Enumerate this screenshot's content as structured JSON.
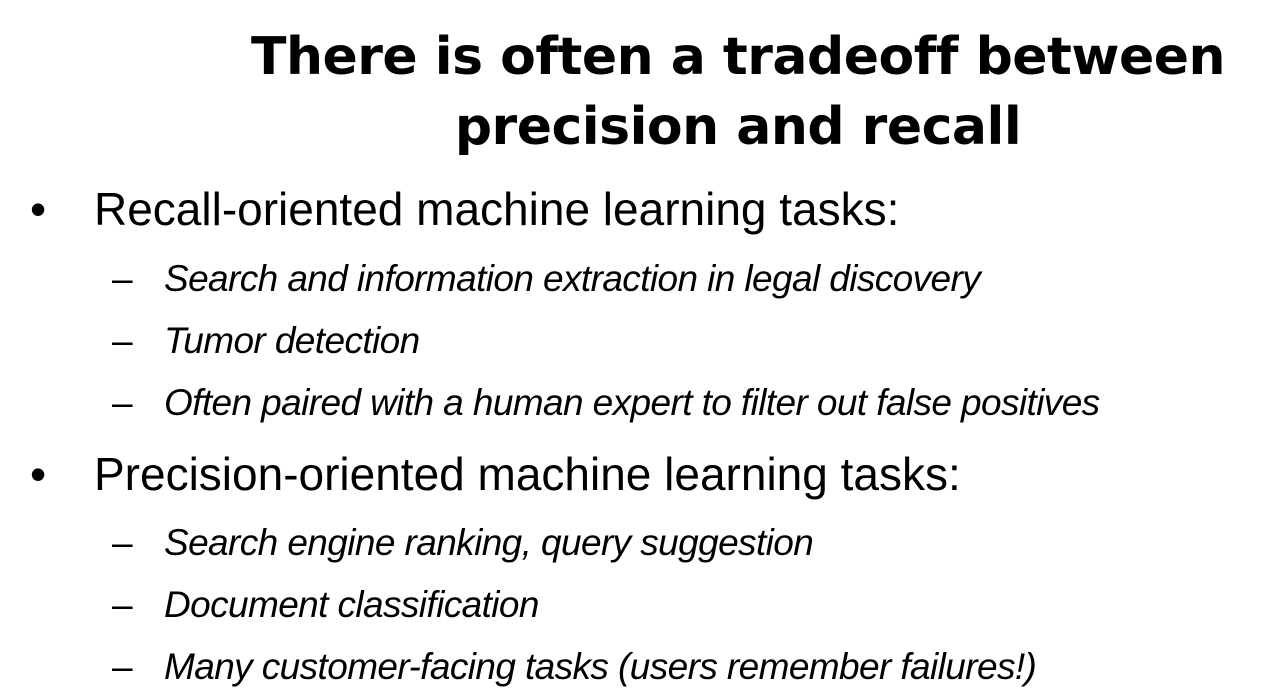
{
  "title": {
    "line1": "There is often a tradeoff between",
    "line2": "precision and recall"
  },
  "sections": [
    {
      "bullet": "•",
      "heading": "Recall-oriented machine learning tasks:",
      "items": [
        "Search and information extraction in legal discovery",
        "Tumor detection",
        "Often paired with a human expert to filter out false positives"
      ]
    },
    {
      "bullet": "•",
      "heading": "Precision-oriented machine learning tasks:",
      "items": [
        "Search engine ranking, query suggestion",
        "Document classification",
        "Many customer-facing tasks (users remember failures!)"
      ]
    }
  ],
  "dash": "–"
}
